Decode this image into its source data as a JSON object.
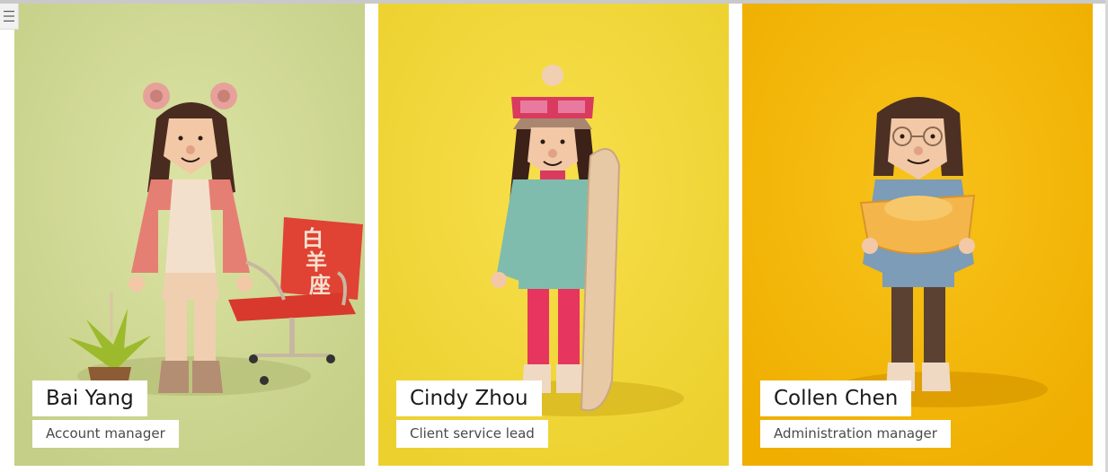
{
  "menu": {
    "icon": "hamburger-menu-icon"
  },
  "team": [
    {
      "name": "Bai Yang",
      "role": "Account manager",
      "background": "#d2db95",
      "chair_text": "白羊座"
    },
    {
      "name": "Cindy Zhou",
      "role": "Client service lead",
      "background": "#f6db3c"
    },
    {
      "name": "Collen Chen",
      "role": "Administration manager",
      "background": "#f6b800"
    }
  ]
}
